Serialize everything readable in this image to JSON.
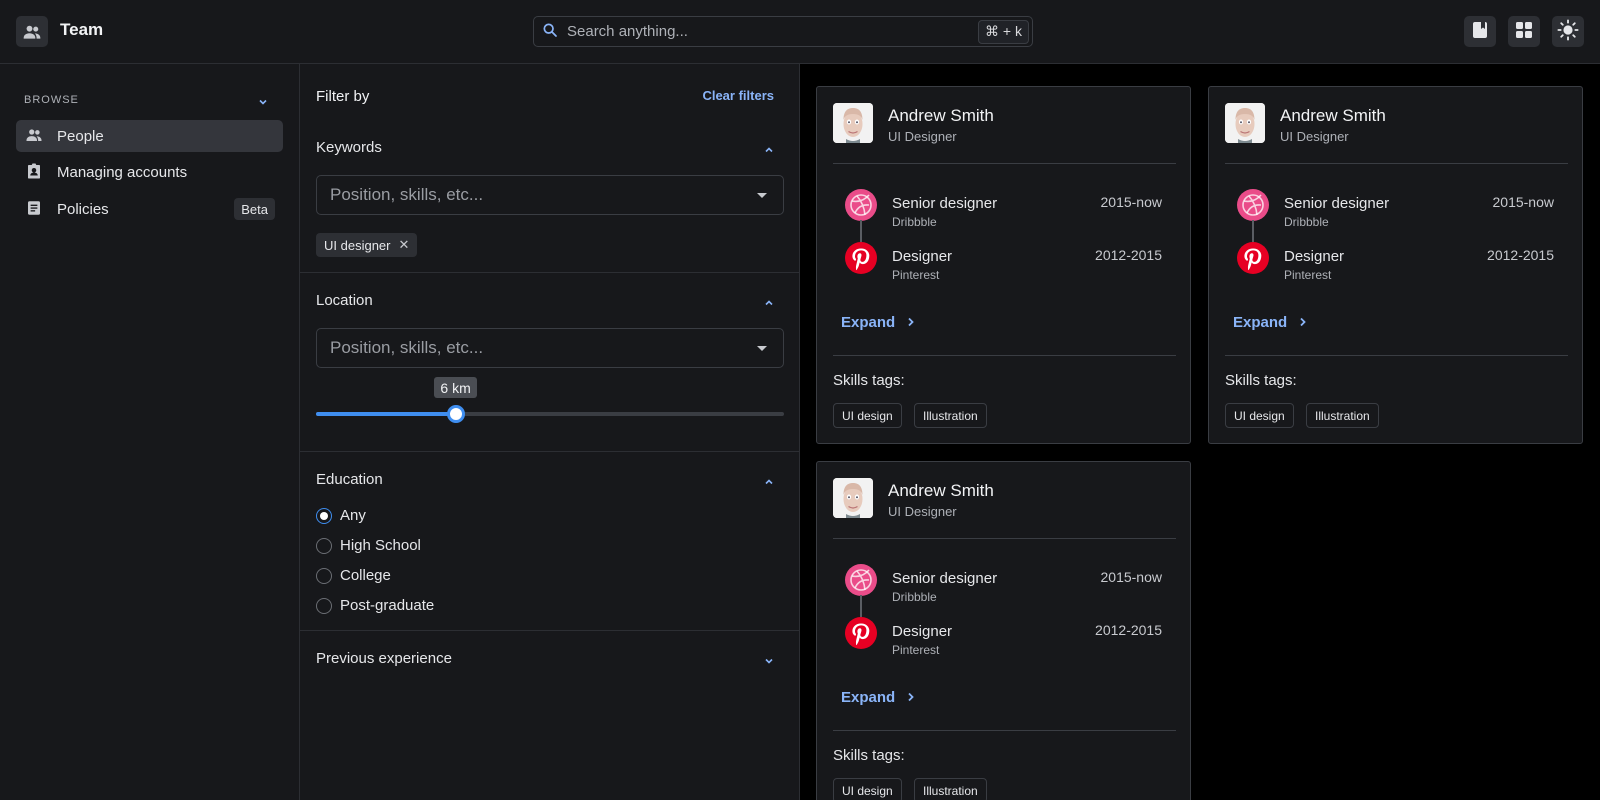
{
  "header": {
    "app_icon": "people-icon",
    "title": "Team",
    "search": {
      "placeholder": "Search anything...",
      "shortcut": "⌘ + k"
    },
    "buttons": [
      "bookmark-icon",
      "grid-icon",
      "sun-icon"
    ]
  },
  "sidebar": {
    "section_label": "BROWSE",
    "items": [
      {
        "label": "People",
        "icon": "people-icon",
        "active": true
      },
      {
        "label": "Managing accounts",
        "icon": "badge-icon"
      },
      {
        "label": "Policies",
        "icon": "document-icon",
        "badge": "Beta"
      }
    ]
  },
  "filter": {
    "title": "Filter by",
    "clear_label": "Clear filters",
    "keywords": {
      "title": "Keywords",
      "placeholder": "Position, skills, etc...",
      "chips": [
        "UI designer"
      ]
    },
    "location": {
      "title": "Location",
      "placeholder": "Position, skills, etc...",
      "distance_label": "6 km",
      "slider_fraction": 0.3
    },
    "education": {
      "title": "Education",
      "options": [
        {
          "label": "Any",
          "checked": true
        },
        {
          "label": "High School"
        },
        {
          "label": "College"
        },
        {
          "label": "Post-graduate"
        }
      ]
    },
    "previous_experience": {
      "title": "Previous experience"
    }
  },
  "cards": [
    {
      "name": "Andrew Smith",
      "role": "UI Designer",
      "experience": [
        {
          "title": "Senior designer",
          "company": "Dribbble",
          "dates": "2015-now",
          "icon": "dribbble-icon"
        },
        {
          "title": "Designer",
          "company": "Pinterest",
          "dates": "2012-2015",
          "icon": "pinterest-icon"
        }
      ],
      "expand_label": "Expand",
      "skills_label": "Skills tags:",
      "tags": [
        "UI design",
        "Illustration"
      ]
    },
    {
      "name": "Andrew Smith",
      "role": "UI Designer",
      "experience": [
        {
          "title": "Senior designer",
          "company": "Dribbble",
          "dates": "2015-now",
          "icon": "dribbble-icon"
        },
        {
          "title": "Designer",
          "company": "Pinterest",
          "dates": "2012-2015",
          "icon": "pinterest-icon"
        }
      ],
      "expand_label": "Expand",
      "skills_label": "Skills tags:",
      "tags": [
        "UI design",
        "Illustration"
      ]
    },
    {
      "name": "Andrew Smith",
      "role": "UI Designer",
      "experience": [
        {
          "title": "Senior designer",
          "company": "Dribbble",
          "dates": "2015-now",
          "icon": "dribbble-icon"
        },
        {
          "title": "Designer",
          "company": "Pinterest",
          "dates": "2012-2015",
          "icon": "pinterest-icon"
        }
      ],
      "expand_label": "Expand",
      "skills_label": "Skills tags:",
      "tags": [
        "UI design",
        "Illustration"
      ]
    }
  ],
  "colors": {
    "accent": "#3f8ef0",
    "link": "#8ab4f8",
    "dribbble": "#ea4c89",
    "pinterest": "#e60023",
    "surface": "#17181b",
    "background": "#000000"
  }
}
